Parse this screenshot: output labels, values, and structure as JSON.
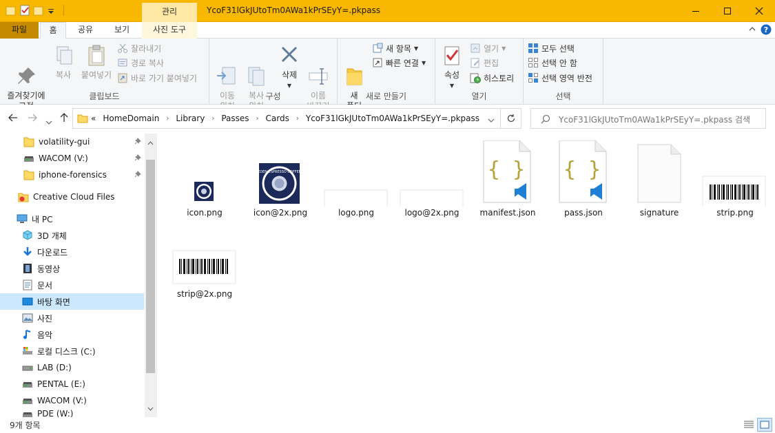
{
  "titlebar": {
    "context_tab": "관리",
    "window_title": "YcoF31lGkJUtoTm0AWa1kPrSEyY=.pkpass"
  },
  "ribbon_tabs": {
    "file": "파일",
    "home": "홈",
    "share": "공유",
    "view": "보기",
    "picture_tools": "사진 도구"
  },
  "clipboard": {
    "pin": "즐겨찾기에\n고정",
    "copy": "복사",
    "paste": "붙여넣기",
    "cut": "잘라내기",
    "copy_path": "경로 복사",
    "paste_shortcut": "바로 가기 붙여넣기",
    "label": "클립보드"
  },
  "organize": {
    "move_to": "이동\n위치",
    "copy_to": "복사\n위치",
    "delete": "삭제",
    "rename": "이름\n바꾸기",
    "label": "구성"
  },
  "new_group": {
    "new_folder": "새\n폴더",
    "new_item": "새 항목",
    "easy_access": "빠른 연결",
    "label": "새로 만들기"
  },
  "open_group": {
    "properties": "속성",
    "open": "열기",
    "edit": "편집",
    "history": "히스토리",
    "label": "열기"
  },
  "select_group": {
    "select_all": "모두 선택",
    "select_none": "선택 안 함",
    "invert": "선택 영역 반전",
    "label": "선택"
  },
  "address": {
    "overflow": "«",
    "crumbs": [
      "HomeDomain",
      "Library",
      "Passes",
      "Cards",
      "YcoF31lGkJUtoTm0AWa1kPrSEyY=.pkpass"
    ]
  },
  "search": {
    "placeholder": "YcoF31lGkJUtoTm0AWa1kPrSEyY=.pkpass 검색"
  },
  "nav": {
    "items": [
      {
        "label": "volatility-gui",
        "icon": "folder-icon"
      },
      {
        "label": "WACOM (V:)",
        "icon": "drive-icon"
      },
      {
        "label": "iphone-forensics",
        "icon": "folder-icon"
      },
      {
        "label": "Creative Cloud Files",
        "icon": "creative-cloud-icon"
      },
      {
        "label": "내 PC",
        "icon": "pc-icon"
      },
      {
        "label": "3D 개체",
        "icon": "3d-objects-icon"
      },
      {
        "label": "다운로드",
        "icon": "download-icon"
      },
      {
        "label": "동영상",
        "icon": "video-icon"
      },
      {
        "label": "문서",
        "icon": "document-icon"
      },
      {
        "label": "바탕 화면",
        "icon": "desktop-icon"
      },
      {
        "label": "사진",
        "icon": "pictures-icon"
      },
      {
        "label": "음악",
        "icon": "music-icon"
      },
      {
        "label": "로컬 디스크 (C:)",
        "icon": "local-disk-icon"
      },
      {
        "label": "LAB (D:)",
        "icon": "drive-icon"
      },
      {
        "label": "PENTAL (E:)",
        "icon": "drive-icon"
      },
      {
        "label": "WACOM (V:)",
        "icon": "drive-icon"
      },
      {
        "label": "PDE (W:)",
        "icon": "drive-icon"
      }
    ]
  },
  "files": [
    {
      "name": "icon.png",
      "kind": "coffee-badge-small"
    },
    {
      "name": "icon@2x.png",
      "kind": "coffee-badge-large"
    },
    {
      "name": "logo.png",
      "kind": "blank-image"
    },
    {
      "name": "logo@2x.png",
      "kind": "blank-image"
    },
    {
      "name": "manifest.json",
      "kind": "json-file"
    },
    {
      "name": "pass.json",
      "kind": "json-file"
    },
    {
      "name": "signature",
      "kind": "generic-file"
    },
    {
      "name": "strip.png",
      "kind": "barcode"
    },
    {
      "name": "strip@2x.png",
      "kind": "barcode"
    }
  ],
  "badge_text": "EDEN ESPRESSO\nCOFFEE",
  "status": {
    "count": "9개 항목"
  },
  "colors": {
    "titlebar": "#f9b800",
    "file_tab": "#c58a00",
    "selection": "#cce8ff",
    "json_brace": "#b5a23a",
    "vscode_blue": "#1f7fd4",
    "badge_navy": "#1c2a5a"
  }
}
